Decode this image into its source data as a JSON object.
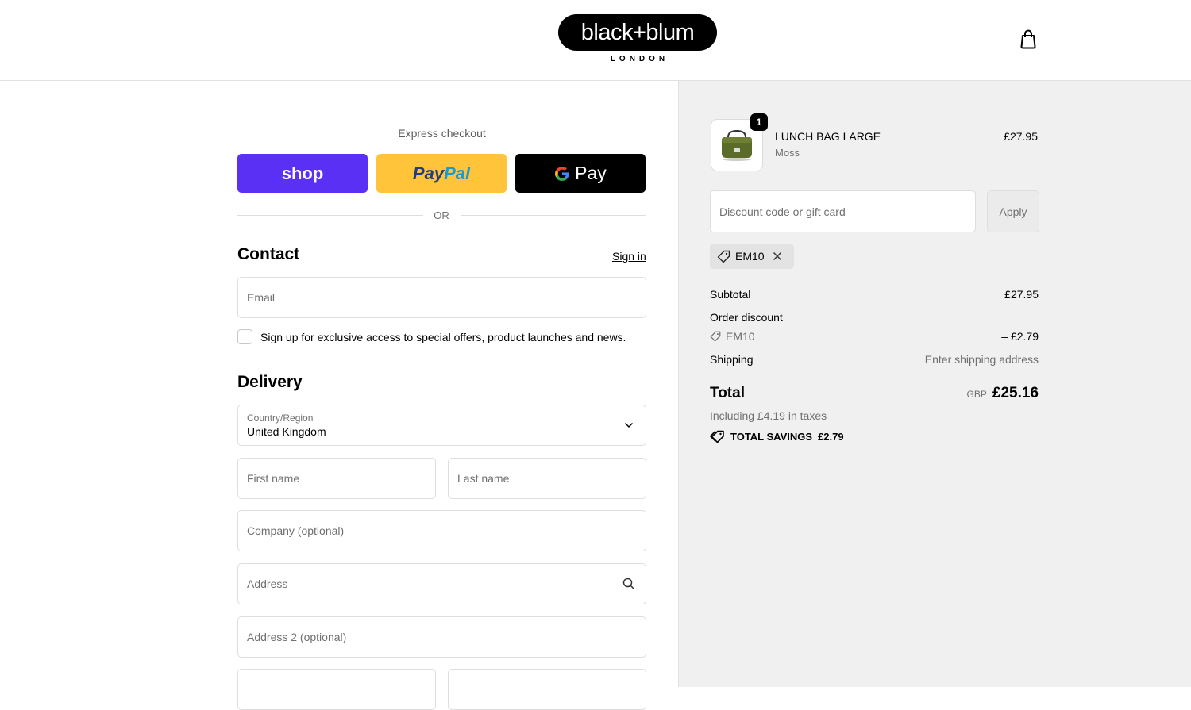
{
  "header": {
    "logo_text": "black+blum",
    "logo_sub": "LONDON"
  },
  "express": {
    "label": "Express checkout",
    "shop_label": "shop",
    "paypal_part1": "Pay",
    "paypal_part2": "Pal",
    "gpay_label": "Pay",
    "or_text": "OR"
  },
  "contact": {
    "title": "Contact",
    "signin_label": "Sign in",
    "email_placeholder": "Email",
    "newsletter_label": "Sign up for exclusive access to special offers, product launches and news."
  },
  "delivery": {
    "title": "Delivery",
    "country_label": "Country/Region",
    "country_value": "United Kingdom",
    "first_name_placeholder": "First name",
    "last_name_placeholder": "Last name",
    "company_placeholder": "Company (optional)",
    "address_placeholder": "Address",
    "address2_placeholder": "Address 2 (optional)"
  },
  "summary": {
    "product": {
      "name": "LUNCH BAG LARGE",
      "variant": "Moss",
      "price": "£27.95",
      "quantity": "1"
    },
    "discount_placeholder": "Discount code or gift card",
    "apply_label": "Apply",
    "applied_code": "EM10",
    "subtotal_label": "Subtotal",
    "subtotal_value": "£27.95",
    "order_discount_label": "Order discount",
    "discount_code": "EM10",
    "discount_value": "– £2.79",
    "shipping_label": "Shipping",
    "shipping_value": "Enter shipping address",
    "total_label": "Total",
    "total_currency": "GBP",
    "total_value": "£25.16",
    "taxes_note": "Including £4.19 in taxes",
    "savings_label": "TOTAL SAVINGS",
    "savings_value": "£2.79"
  },
  "colors": {
    "shop_purple": "#5a31f4",
    "paypal_yellow": "#ffc439",
    "summary_bg": "#f0f0f0"
  },
  "icons": {
    "cart": "shopping-bag-icon",
    "chevron": "chevron-down-icon",
    "search": "search-icon",
    "tag": "tag-icon",
    "close": "close-icon"
  }
}
